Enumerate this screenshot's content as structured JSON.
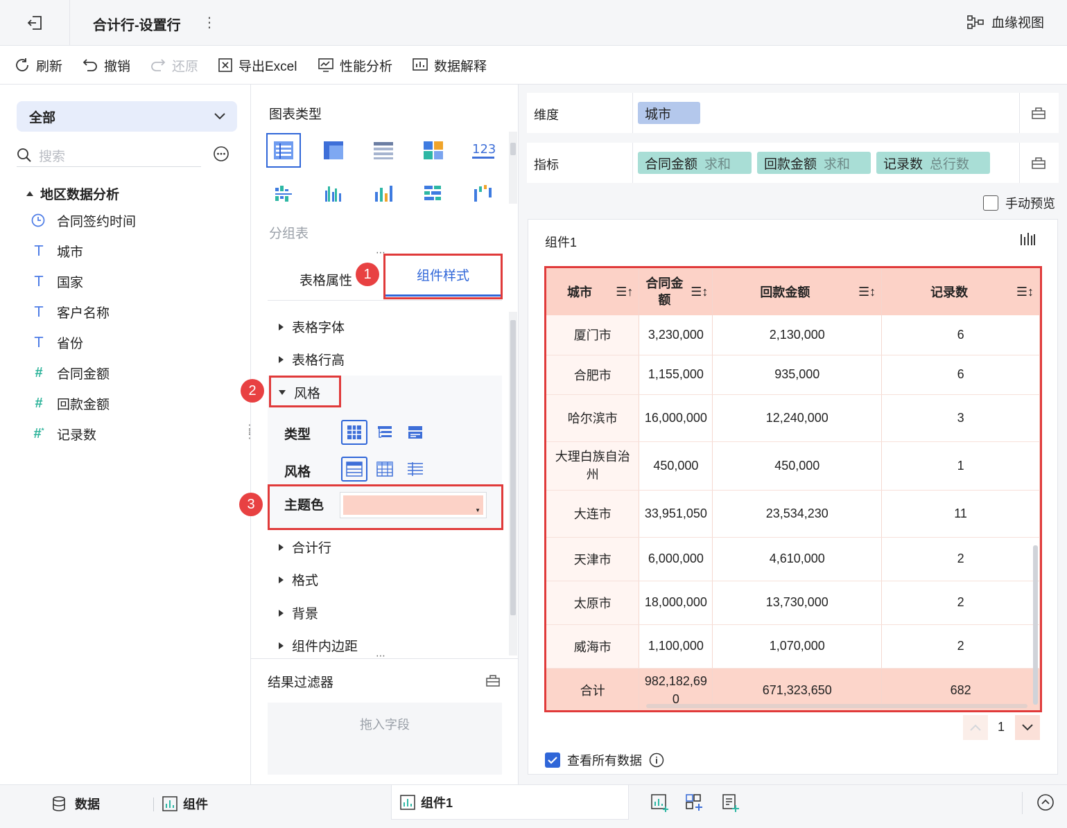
{
  "header": {
    "title": "合计行-设置行",
    "lineage": "血缘视图"
  },
  "toolbar": {
    "refresh": "刷新",
    "undo": "撤销",
    "redo": "还原",
    "export": "导出Excel",
    "perf": "性能分析",
    "explain": "数据解释"
  },
  "left": {
    "dropdown": "全部",
    "search_placeholder": "搜索",
    "dataset": "地区数据分析",
    "fields": [
      {
        "type": "clock-icon",
        "name": "合同签约时间"
      },
      {
        "type": "text-type-icon",
        "name": "城市"
      },
      {
        "type": "text-type-icon",
        "name": "国家"
      },
      {
        "type": "text-type-icon",
        "name": "客户名称"
      },
      {
        "type": "text-type-icon",
        "name": "省份"
      },
      {
        "type": "number-type-icon",
        "name": "合同金额"
      },
      {
        "type": "number-type-icon",
        "name": "回款金额"
      },
      {
        "type": "calc-number-icon",
        "name": "记录数"
      }
    ]
  },
  "middle": {
    "chart_type_title": "图表类型",
    "chart_type_name": "分组表",
    "tabs": [
      "表格属性",
      "组件样式"
    ],
    "sections": {
      "font": "表格字体",
      "row_height": "表格行高",
      "style": "风格",
      "total_row": "合计行",
      "format": "格式",
      "background": "背景",
      "padding": "组件内边距"
    },
    "style_labels": {
      "type": "类型",
      "style": "风格",
      "theme": "主题色"
    },
    "theme_color": "#fcd2c7",
    "badges": [
      "1",
      "2",
      "3"
    ],
    "filter_title": "结果过滤器",
    "filter_drop": "拖入字段"
  },
  "right": {
    "dimension_label": "维度",
    "dimension_chips": [
      "城市"
    ],
    "measure_label": "指标",
    "measure_chips": [
      {
        "name": "合同金额",
        "agg": "求和"
      },
      {
        "name": "回款金额",
        "agg": "求和"
      },
      {
        "name": "记录数",
        "agg": "总行数"
      }
    ],
    "manual_preview": "手动预览",
    "component_title": "组件1",
    "table": {
      "headers": [
        "城市",
        "合同金额",
        "回款金额",
        "记录数"
      ],
      "rows": [
        [
          "厦门市",
          "3,230,000",
          "2,130,000",
          "6"
        ],
        [
          "合肥市",
          "1,155,000",
          "935,000",
          "6"
        ],
        [
          "哈尔滨市",
          "16,000,000",
          "12,240,000",
          "3"
        ],
        [
          "大理白族自治州",
          "450,000",
          "450,000",
          "1"
        ],
        [
          "大连市",
          "33,951,050",
          "23,534,230",
          "11"
        ],
        [
          "天津市",
          "6,000,000",
          "4,610,000",
          "2"
        ],
        [
          "太原市",
          "18,000,000",
          "13,730,000",
          "2"
        ],
        [
          "威海市",
          "1,100,000",
          "1,070,000",
          "2"
        ]
      ],
      "total": [
        "合计",
        "982,182,690",
        "671,323,650",
        "682"
      ]
    },
    "page_number": "1",
    "view_all": "查看所有数据"
  },
  "bottom": {
    "data_tab": "数据",
    "component_tab": "组件",
    "active_tab": "组件1"
  },
  "colors": {
    "accent": "#2f66d8",
    "highlight": "#e03a3a",
    "dim_chip": "#b4c8ec",
    "measure_chip": "#a9ded6"
  }
}
